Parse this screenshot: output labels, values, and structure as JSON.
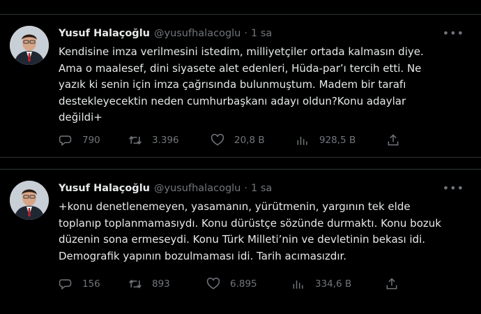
{
  "tweets": [
    {
      "author": "Yusuf Halaçoğlu",
      "handle": "@yusufhalacoglu",
      "separator": "·",
      "time": "1 sa",
      "text": "Kendisine imza verilmesini istedim, milliyetçiler ortada kalmasın diye. Ama o maalesef, dini siyasete alet edenleri, Hüda-par’ı tercih etti. Ne yazık ki senin için imza çağrısında bulunmuştum. Madem bir tarafı destekleyecektin neden cumhurbaşkanı adayı oldun?Konu adaylar değildi+",
      "replies": "790",
      "retweets": "3.396",
      "likes": "20,8 B",
      "views": "928,5 B"
    },
    {
      "author": "Yusuf Halaçoğlu",
      "handle": "@yusufhalacoglu",
      "separator": "·",
      "time": "1 sa",
      "text": "+konu denetlenemeyen, yasamanın, yürütmenin, yargının tek elde toplanıp toplanmamasıydı. Konu dürüstçe sözünde durmaktı. Konu bozuk düzenin sona ermeseydi. Konu Türk Milleti’nin ve devletinin bekası idi. Demografik yapının bozulmaması idi. Tarih acımasızdır.",
      "replies": "156",
      "retweets": "893",
      "likes": "6.895",
      "views": "334,6 B"
    }
  ],
  "icons": {
    "more": "more-horizontal-icon",
    "reply": "reply-bubble-icon",
    "retweet": "retweet-arrows-icon",
    "like": "heart-icon",
    "views": "bar-chart-icon",
    "share": "share-upload-icon"
  },
  "colors": {
    "background": "#000000",
    "text": "#e7e9ea",
    "muted": "#71767b",
    "divider": "#2f3336"
  }
}
